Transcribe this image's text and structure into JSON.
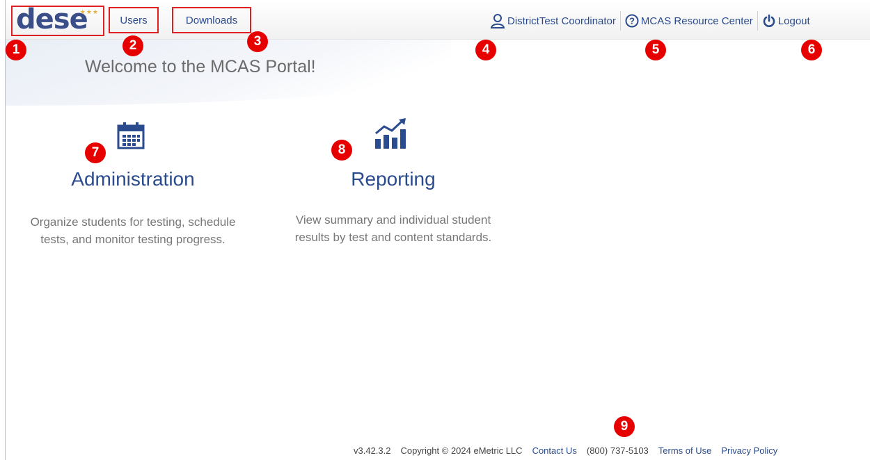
{
  "header": {
    "logo_text": "dese",
    "nav": {
      "users": "Users",
      "downloads": "Downloads"
    },
    "user_name": "DistrictTest Coordinator",
    "resource_center": "MCAS Resource Center",
    "logout": "Logout"
  },
  "main": {
    "welcome": "Welcome to the MCAS Portal!",
    "cards": [
      {
        "title": "Administration",
        "description": "Organize students for testing, schedule tests, and monitor testing progress.",
        "icon": "calendar-icon"
      },
      {
        "title": "Reporting",
        "description": "View summary and individual student results by test and content standards.",
        "icon": "chart-trend-icon"
      }
    ]
  },
  "footer": {
    "version": "v3.42.3.2",
    "copyright": "Copyright © 2024 eMetric LLC",
    "contact": "Contact Us",
    "phone": "(800) 737-5103",
    "terms": "Terms of Use",
    "privacy": "Privacy Policy"
  },
  "callouts": [
    "1",
    "2",
    "3",
    "4",
    "5",
    "6",
    "7",
    "8",
    "9"
  ],
  "colors": {
    "brand": "#3a4f8a",
    "link": "#2a4b8d",
    "callout": "#e60000",
    "highlight_border": "#e02020"
  }
}
